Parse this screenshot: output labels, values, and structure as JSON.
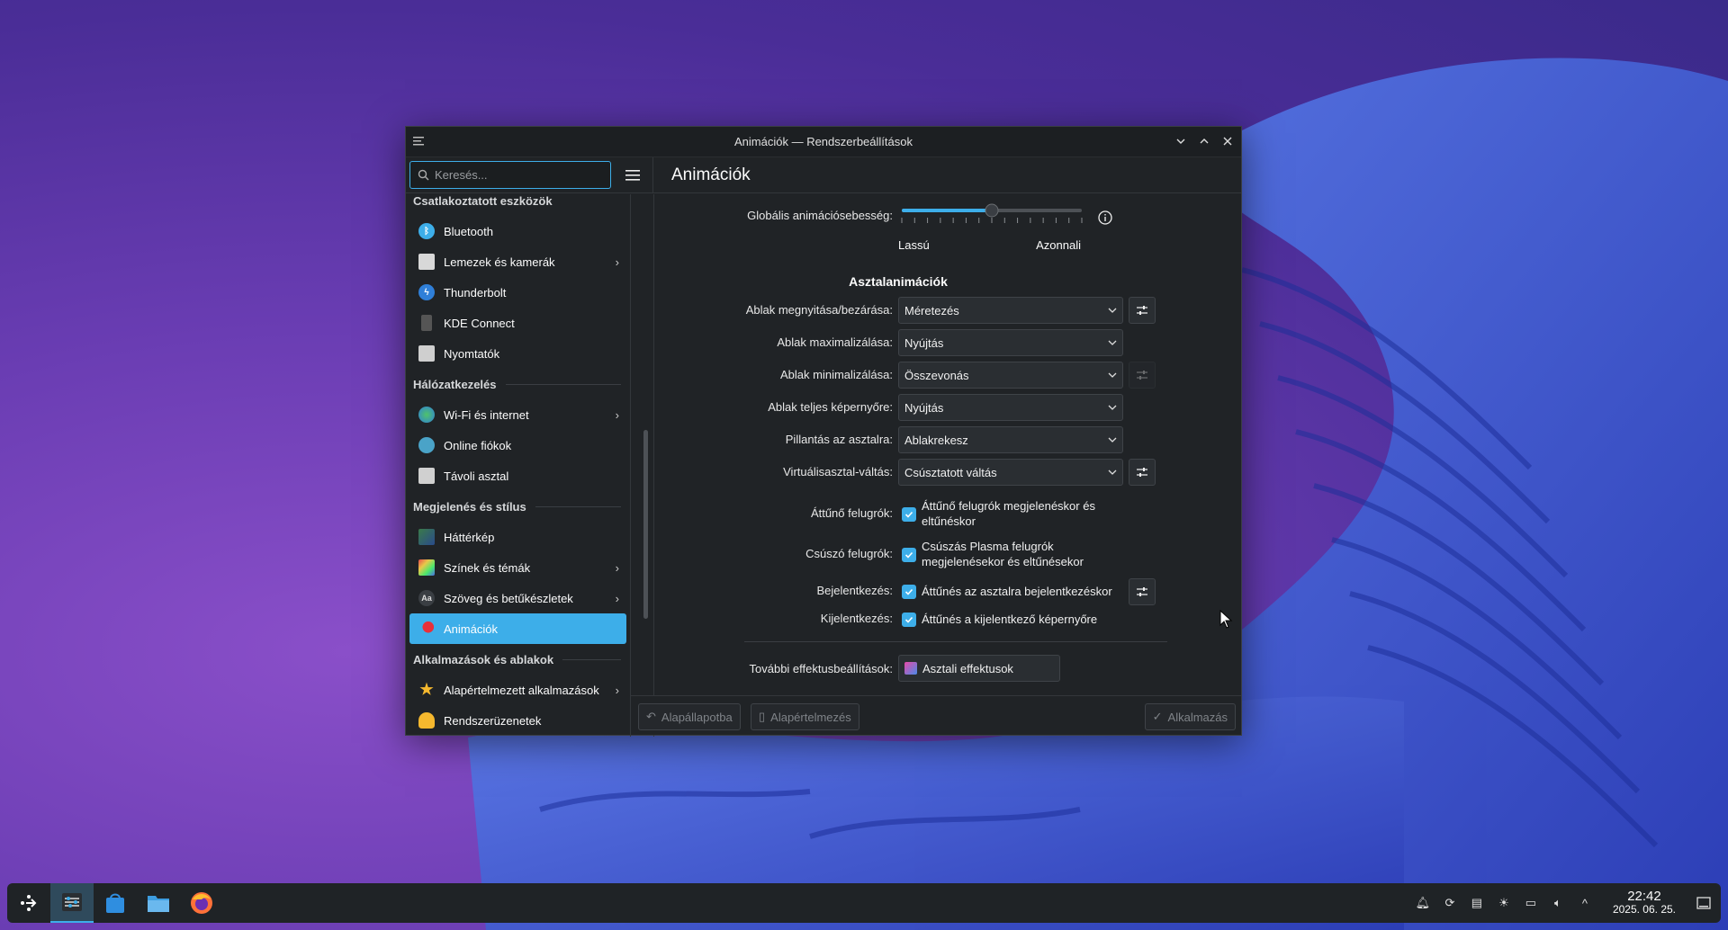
{
  "window": {
    "title": "Animációk — Rendszerbeállítások"
  },
  "search": {
    "placeholder": "Keresés..."
  },
  "page": {
    "title": "Animációk"
  },
  "sidebar": {
    "sections": [
      {
        "title": "Csatlakoztatott eszközök",
        "items": [
          {
            "label": "Bluetooth",
            "icon": "bluetooth-icon",
            "chevron": false
          },
          {
            "label": "Lemezek és kamerák",
            "icon": "disk-icon",
            "chevron": true
          },
          {
            "label": "Thunderbolt",
            "icon": "thunderbolt-icon",
            "chevron": false
          },
          {
            "label": "KDE Connect",
            "icon": "phone-icon",
            "chevron": false
          },
          {
            "label": "Nyomtatók",
            "icon": "printer-icon",
            "chevron": false
          }
        ]
      },
      {
        "title": "Hálózatkezelés",
        "items": [
          {
            "label": "Wi-Fi és internet",
            "icon": "globe-icon",
            "chevron": true
          },
          {
            "label": "Online fiókok",
            "icon": "accounts-icon",
            "chevron": false
          },
          {
            "label": "Távoli asztal",
            "icon": "remote-desktop-icon",
            "chevron": false
          }
        ]
      },
      {
        "title": "Megjelenés és stílus",
        "items": [
          {
            "label": "Háttérkép",
            "icon": "wallpaper-icon",
            "chevron": false
          },
          {
            "label": "Színek és témák",
            "icon": "colors-icon",
            "chevron": true
          },
          {
            "label": "Szöveg és betűkészletek",
            "icon": "fonts-icon",
            "chevron": true
          },
          {
            "label": "Animációk",
            "icon": "animation-icon",
            "chevron": false,
            "active": true
          }
        ]
      },
      {
        "title": "Alkalmazások és ablakok",
        "items": [
          {
            "label": "Alapértelmezett alkalmazások",
            "icon": "star-icon",
            "chevron": true
          },
          {
            "label": "Rendszerüzenetek",
            "icon": "bell-icon",
            "chevron": false
          }
        ]
      }
    ]
  },
  "speed": {
    "label": "Globális animációsebesség:",
    "slow": "Lassú",
    "instant": "Azonnali",
    "value_fraction": 0.5
  },
  "desktop": {
    "heading": "Asztalanimációk"
  },
  "settings": [
    {
      "label": "Ablak megnyitása/bezárása:",
      "value": "Méretezés",
      "config": "enabled"
    },
    {
      "label": "Ablak maximalizálása:",
      "value": "Nyújtás",
      "config": "none"
    },
    {
      "label": "Ablak minimalizálása:",
      "value": "Összevonás",
      "config": "disabled"
    },
    {
      "label": "Ablak teljes képernyőre:",
      "value": "Nyújtás",
      "config": "none"
    },
    {
      "label": "Pillantás az asztalra:",
      "value": "Ablakrekesz",
      "config": "none"
    },
    {
      "label": "Virtuálisasztal-váltás:",
      "value": "Csúsztatott váltás",
      "config": "enabled"
    }
  ],
  "checks": [
    {
      "label": "Áttűnő felugrók:",
      "text1": "Áttűnő felugrók megjelenéskor és",
      "text2": "eltűnéskor",
      "checked": true
    },
    {
      "label": "Csúszó felugrók:",
      "text1": "Csúszás Plasma felugrók",
      "text2": "megjelenésekor és eltűnésekor",
      "checked": true
    },
    {
      "label": "Bejelentkezés:",
      "text1": "Áttűnés az asztalra bejelentkezéskor",
      "text2": "",
      "checked": true
    },
    {
      "label": "Kijelentkezés:",
      "text1": "Áttűnés a kijelentkező képernyőre",
      "text2": "",
      "checked": true
    }
  ],
  "more": {
    "label": "További effektusbeállítások:",
    "button": "Asztali effektusok"
  },
  "buttons": {
    "help": "Alapállapotba",
    "defaults": "Alapértelmezés",
    "apply": "Alkalmazás"
  },
  "clock": {
    "time": "22:42",
    "date": "2025. 06. 25."
  }
}
